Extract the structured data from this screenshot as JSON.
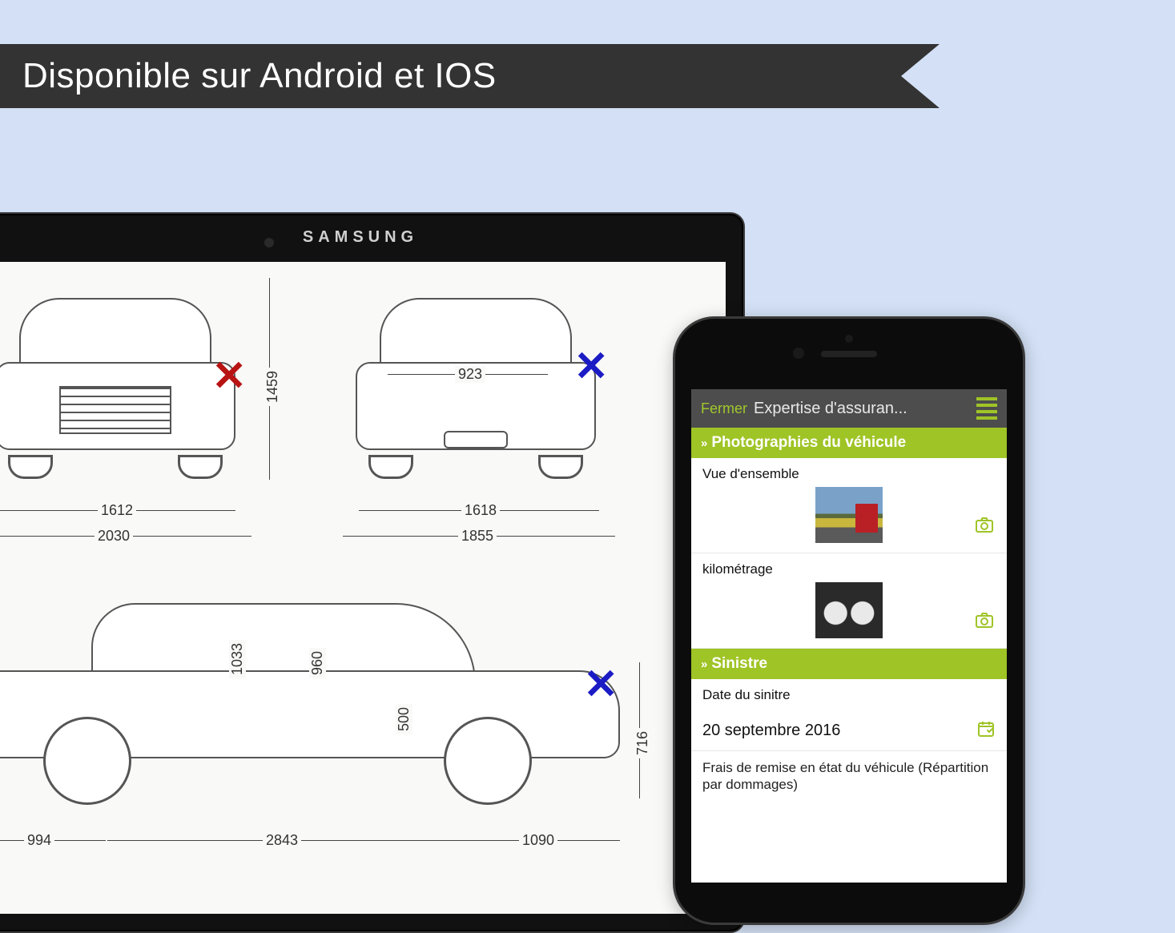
{
  "banner": {
    "text": "Disponible sur Android et IOS"
  },
  "colors": {
    "accent": "#9fc426",
    "banner": "#333333",
    "background": "#d3e0f5"
  },
  "tablet": {
    "brand": "SAMSUNG",
    "blueprint_dimensions": {
      "height_mm": "1459",
      "track_mm": "1612",
      "width_mm": "2030",
      "rear_track_mm": "1618",
      "rear_width_mm": "1855",
      "rear_opening_mm": "923",
      "side_front_overhang_mm": "994",
      "wheelbase_mm": "2843",
      "side_rear_overhang_mm": "1090",
      "side_height_mm": "716",
      "interior_height_a_mm": "1033",
      "interior_height_b_mm": "960",
      "interior_height_c_mm": "500"
    },
    "damage_marks": [
      {
        "view": "front",
        "mark": "X",
        "color": "red"
      },
      {
        "view": "rear",
        "mark": "X",
        "color": "blue"
      },
      {
        "view": "side-front",
        "mark": "X",
        "color": "red"
      },
      {
        "view": "side-rear",
        "mark": "X",
        "color": "blue"
      }
    ]
  },
  "phone": {
    "header": {
      "close_label": "Fermer",
      "title": "Expertise d'assuran..."
    },
    "sections": [
      {
        "title": "Photographies du véhicule",
        "rows": [
          {
            "label": "Vue d'ensemble",
            "type": "photo"
          },
          {
            "label": "kilométrage",
            "type": "photo"
          }
        ]
      },
      {
        "title": "Sinistre",
        "rows": [
          {
            "label": "Date du sinitre",
            "type": "label"
          },
          {
            "value": "20 septembre 2016",
            "type": "date"
          },
          {
            "label": "Frais de remise en état du véhicule (Répartition par dommages)",
            "type": "note"
          }
        ]
      }
    ]
  }
}
